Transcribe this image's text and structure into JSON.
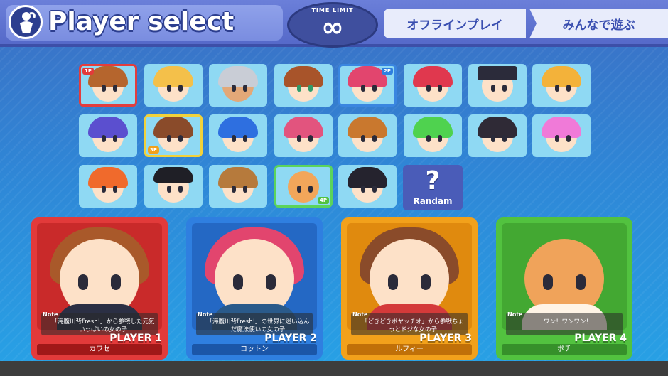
{
  "header": {
    "title": "Player select",
    "timer_label": "TIME LIMIT",
    "timer_value": "∞",
    "mode_primary": "オフラインプレイ",
    "mode_secondary": "みんなで遊ぶ"
  },
  "grid": {
    "random_label": "Randam",
    "random_symbol": "?",
    "tags": [
      "1P",
      "2P",
      "3P",
      "4P"
    ]
  },
  "players": [
    {
      "label": "PLAYER 1",
      "character": "カワセ",
      "note_label": "Note",
      "note": "「海腹川背Fresh!」から参戦した元気いっぱいの女の子",
      "color": "#e23a3a"
    },
    {
      "label": "PLAYER 2",
      "character": "コットン",
      "note_label": "Note",
      "note": "「海腹川背Fresh!」の世界に迷い込んだ魔法使いの女の子",
      "color": "#2f7fe0"
    },
    {
      "label": "PLAYER 3",
      "character": "ルフィー",
      "note_label": "Note",
      "note": "「どきどきポヤッチオ」から参戦ちょっとドジな女の子",
      "color": "#f2a11b"
    },
    {
      "label": "PLAYER 4",
      "character": "ポチ",
      "note_label": "Note",
      "note": "ワン！ワンワン！",
      "color": "#52c23f"
    }
  ]
}
